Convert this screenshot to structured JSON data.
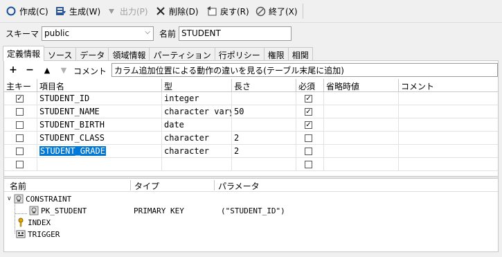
{
  "toolbar": {
    "create": "作成(C)",
    "generate": "生成(W)",
    "output": "出力(P)",
    "delete": "削除(D)",
    "back": "戻す(R)",
    "exit": "終了(X)"
  },
  "schema": {
    "label": "スキーマ",
    "value": "public",
    "name_label": "名前",
    "name_value": "STUDENT"
  },
  "tabs": [
    "定義情報",
    "ソース",
    "データ",
    "領域情報",
    "パーティション",
    "行ポリシー",
    "権限",
    "相関"
  ],
  "active_tab": "定義情報",
  "columns_toolbar": {
    "add": "+",
    "remove": "−",
    "up": "▲",
    "down": "▼",
    "comment_label": "コメント",
    "comment_value": "カラム追加位置による動作の違いを見る(テーブル末尾に追加)"
  },
  "grid": {
    "headers": [
      "主キー",
      "項目名",
      "型",
      "長さ",
      "必須",
      "省略時値",
      "コメント"
    ],
    "rows": [
      {
        "pk": true,
        "name": "STUDENT_ID",
        "type": "integer",
        "length": "",
        "required": true
      },
      {
        "pk": false,
        "name": "STUDENT_NAME",
        "type": "character varying",
        "length": "50",
        "required": true
      },
      {
        "pk": false,
        "name": "STUDENT_BIRTH",
        "type": "date",
        "length": "",
        "required": true
      },
      {
        "pk": false,
        "name": "STUDENT_CLASS",
        "type": "character",
        "length": "2",
        "required": false
      },
      {
        "pk": false,
        "name": "STUDENT_GRADE",
        "type": "character",
        "length": "2",
        "required": false,
        "selected": true
      },
      {
        "pk": false,
        "name": "",
        "type": "",
        "length": "",
        "required": false
      }
    ]
  },
  "tree": {
    "headers": [
      "名前",
      "タイプ",
      "パラメータ"
    ],
    "nodes": [
      {
        "name": "CONSTRAINT",
        "type": "",
        "param": ""
      },
      {
        "name": "PK_STUDENT",
        "type": "PRIMARY KEY",
        "param": "(\"STUDENT_ID\")"
      },
      {
        "name": "INDEX",
        "type": "",
        "param": ""
      },
      {
        "name": "TRIGGER",
        "type": "",
        "param": ""
      }
    ]
  }
}
